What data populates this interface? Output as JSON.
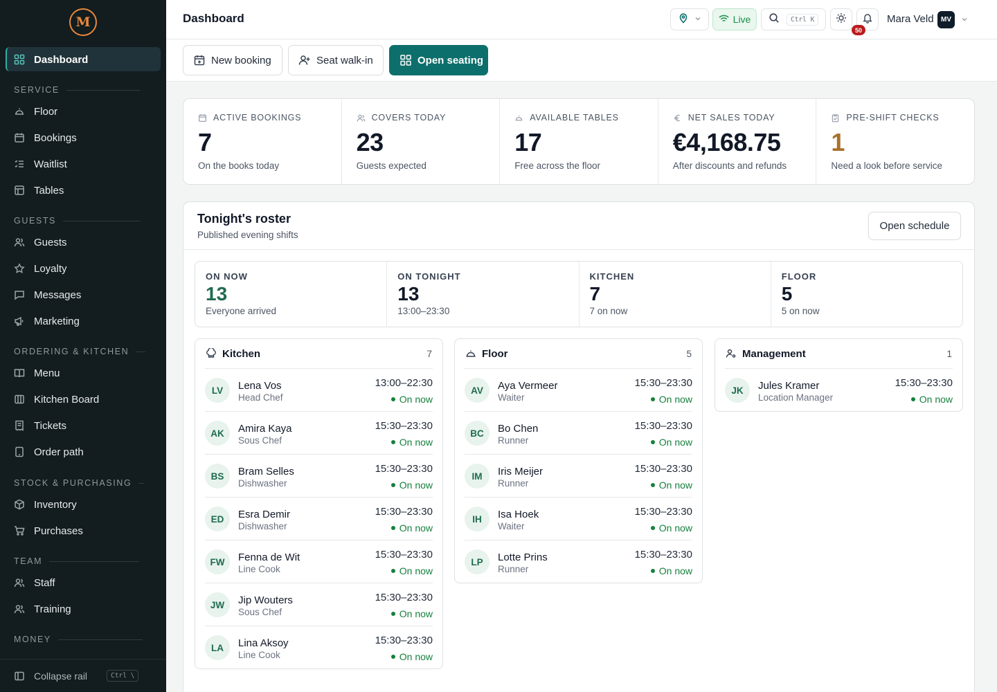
{
  "app": {
    "logo_text": "M"
  },
  "sidebar": {
    "active": {
      "label": "Dashboard"
    },
    "sections": [
      {
        "title": "SERVICE",
        "items": [
          "Floor",
          "Bookings",
          "Waitlist",
          "Tables"
        ]
      },
      {
        "title": "GUESTS",
        "items": [
          "Guests",
          "Loyalty",
          "Messages",
          "Marketing"
        ]
      },
      {
        "title": "ORDERING & KITCHEN",
        "items": [
          "Menu",
          "Kitchen Board",
          "Tickets",
          "Order path"
        ]
      },
      {
        "title": "STOCK & PURCHASING",
        "items": [
          "Inventory",
          "Purchases"
        ]
      },
      {
        "title": "TEAM",
        "items": [
          "Staff",
          "Training"
        ]
      },
      {
        "title": "MONEY",
        "items": []
      }
    ],
    "collapse_label": "Collapse rail",
    "collapse_shortcut": "Ctrl \\"
  },
  "header": {
    "title": "Dashboard",
    "live_label": "Live",
    "search_shortcut": "Ctrl K",
    "notifications_count": "50",
    "user_name": "Mara Veld",
    "user_initials": "MV"
  },
  "actions": {
    "new_booking": "New booking",
    "seat_walk_in": "Seat walk-in",
    "open_seating": "Open seating"
  },
  "stats": [
    {
      "label": "ACTIVE BOOKINGS",
      "value": "7",
      "sub": "On the books today",
      "icon": "calendar-icon"
    },
    {
      "label": "COVERS TODAY",
      "value": "23",
      "sub": "Guests expected",
      "icon": "users-icon"
    },
    {
      "label": "AVAILABLE TABLES",
      "value": "17",
      "sub": "Free across the floor",
      "icon": "table-icon"
    },
    {
      "label": "NET SALES TODAY",
      "value": "€4,168.75",
      "sub": "After discounts and refunds",
      "icon": "euro-icon"
    },
    {
      "label": "PRE-SHIFT CHECKS",
      "value": "1",
      "sub": "Need a look before service",
      "icon": "clipboard-icon",
      "accent": "#a8712b"
    }
  ],
  "roster": {
    "title": "Tonight's roster",
    "subtitle": "Published evening shifts",
    "open_schedule": "Open schedule",
    "summary": [
      {
        "label": "ON NOW",
        "value": "13",
        "sub": "Everyone arrived"
      },
      {
        "label": "ON TONIGHT",
        "value": "13",
        "sub": "13:00–23:30"
      },
      {
        "label": "KITCHEN",
        "value": "7",
        "sub": "7 on now"
      },
      {
        "label": "FLOOR",
        "value": "5",
        "sub": "5 on now"
      }
    ],
    "columns": [
      {
        "title": "Kitchen",
        "count": "7",
        "icon": "chef-hat-icon",
        "people": [
          {
            "initials": "LV",
            "name": "Lena Vos",
            "role": "Head Chef",
            "time": "13:00–22:30",
            "status": "On now"
          },
          {
            "initials": "AK",
            "name": "Amira Kaya",
            "role": "Sous Chef",
            "time": "15:30–23:30",
            "status": "On now"
          },
          {
            "initials": "BS",
            "name": "Bram Selles",
            "role": "Dishwasher",
            "time": "15:30–23:30",
            "status": "On now"
          },
          {
            "initials": "ED",
            "name": "Esra Demir",
            "role": "Dishwasher",
            "time": "15:30–23:30",
            "status": "On now"
          },
          {
            "initials": "FW",
            "name": "Fenna de Wit",
            "role": "Line Cook",
            "time": "15:30–23:30",
            "status": "On now"
          },
          {
            "initials": "JW",
            "name": "Jip Wouters",
            "role": "Sous Chef",
            "time": "15:30–23:30",
            "status": "On now"
          },
          {
            "initials": "LA",
            "name": "Lina Aksoy",
            "role": "Line Cook",
            "time": "15:30–23:30",
            "status": "On now"
          }
        ]
      },
      {
        "title": "Floor",
        "count": "5",
        "icon": "cloche-icon",
        "people": [
          {
            "initials": "AV",
            "name": "Aya Vermeer",
            "role": "Waiter",
            "time": "15:30–23:30",
            "status": "On now"
          },
          {
            "initials": "BC",
            "name": "Bo Chen",
            "role": "Runner",
            "time": "15:30–23:30",
            "status": "On now"
          },
          {
            "initials": "IM",
            "name": "Iris Meijer",
            "role": "Runner",
            "time": "15:30–23:30",
            "status": "On now"
          },
          {
            "initials": "IH",
            "name": "Isa Hoek",
            "role": "Waiter",
            "time": "15:30–23:30",
            "status": "On now"
          },
          {
            "initials": "LP",
            "name": "Lotte Prins",
            "role": "Runner",
            "time": "15:30–23:30",
            "status": "On now"
          }
        ]
      },
      {
        "title": "Management",
        "count": "1",
        "icon": "user-cog-icon",
        "people": [
          {
            "initials": "JK",
            "name": "Jules Kramer",
            "role": "Location Manager",
            "time": "15:30–23:30",
            "status": "On now"
          }
        ]
      }
    ]
  }
}
